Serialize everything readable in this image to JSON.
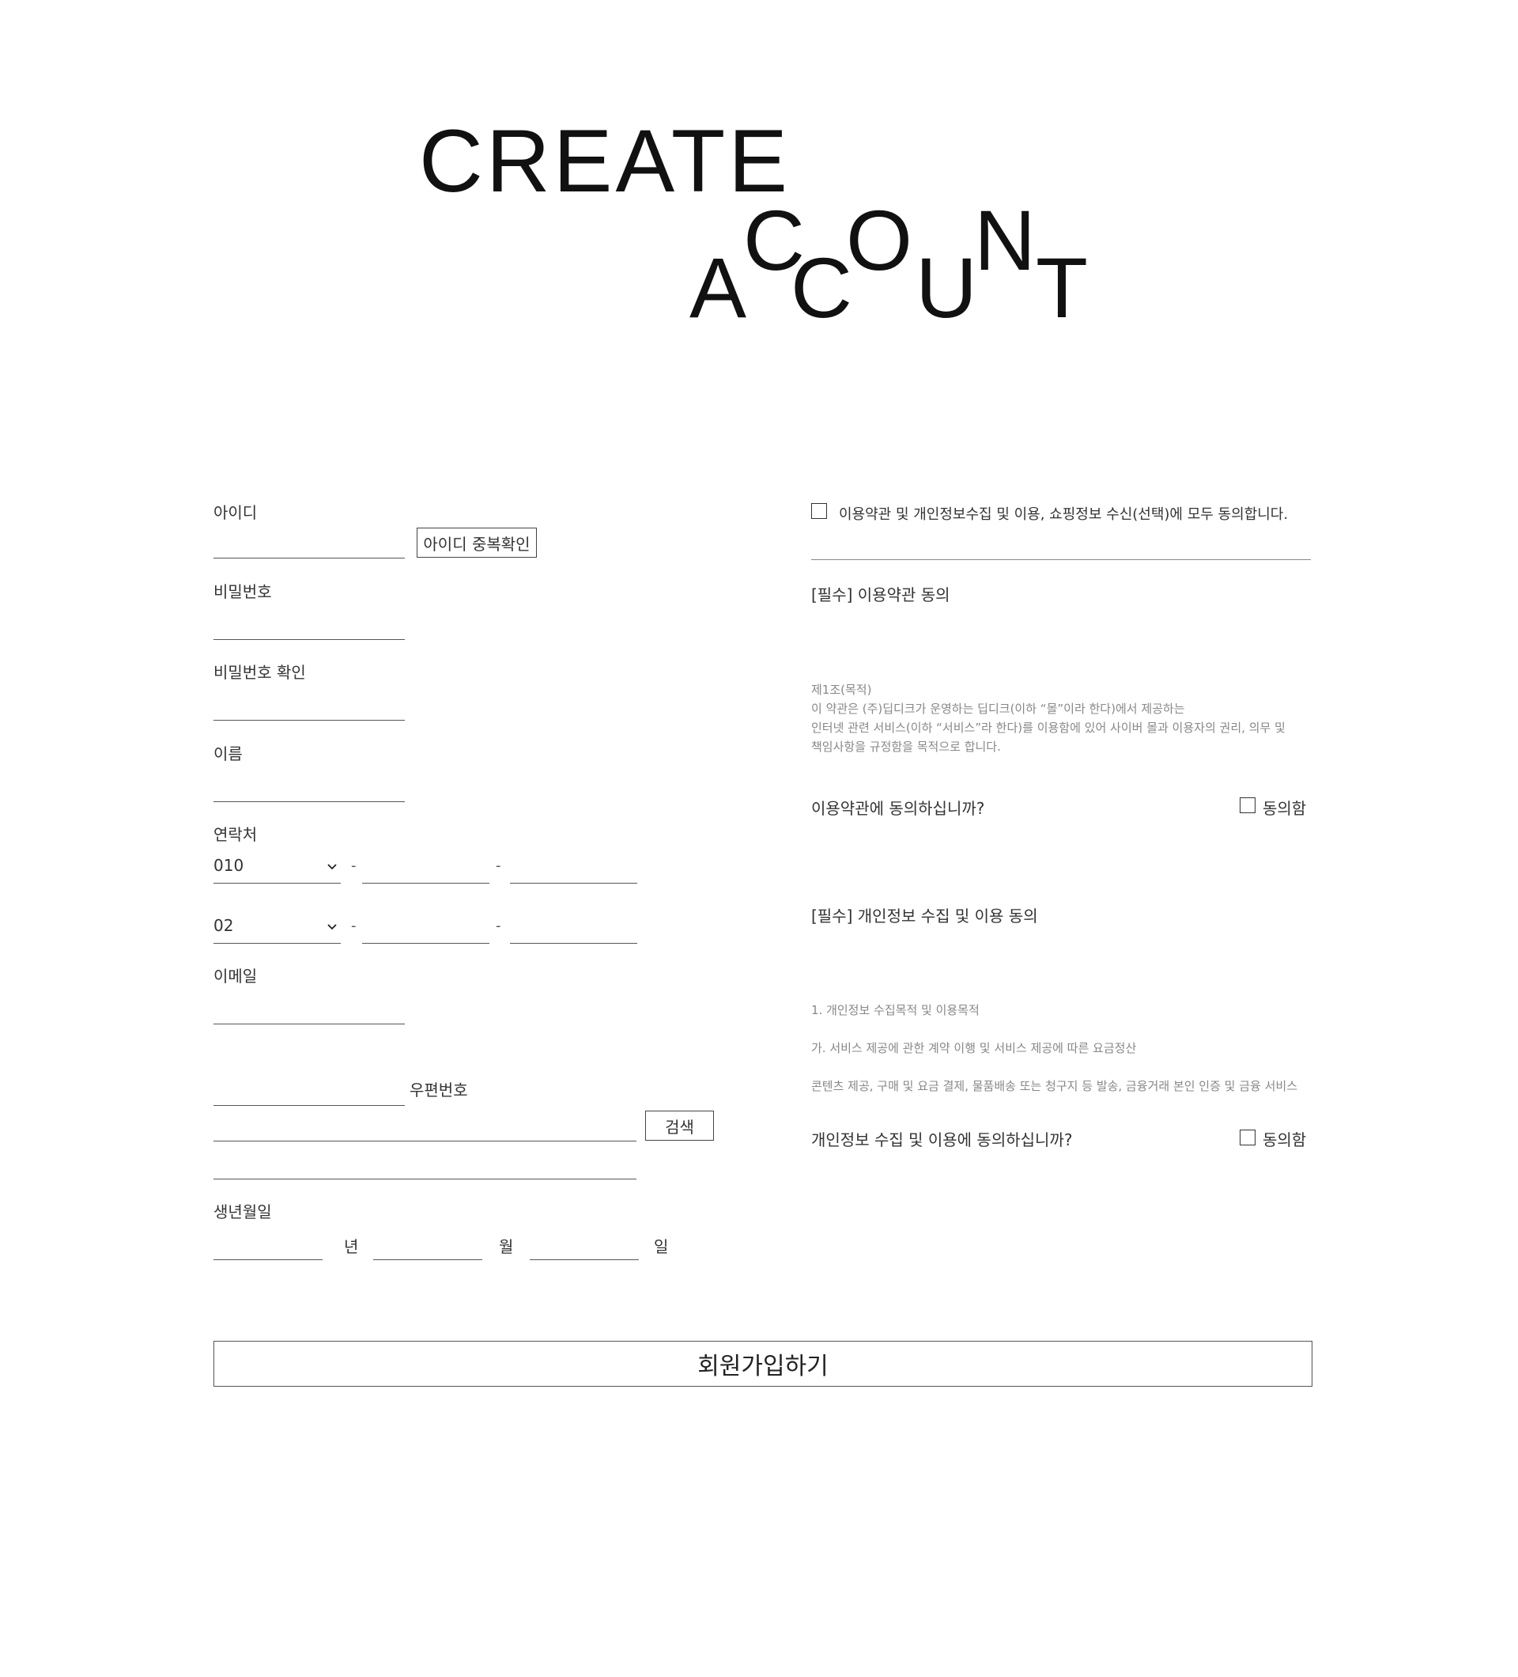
{
  "header": {
    "word1": "CREATE",
    "word2_letters": [
      "A",
      "C",
      "C",
      "O",
      "U",
      "N",
      "T"
    ]
  },
  "form": {
    "id_label": "아이디",
    "id_check_button": "아이디 중복확인",
    "password_label": "비밀번호",
    "password_confirm_label": "비밀번호 확인",
    "name_label": "이름",
    "contact_label": "연락처",
    "phone1_prefix": "010",
    "phone2_prefix": "02",
    "dash": "-",
    "email_label": "이메일",
    "postcode_label": "우편번호",
    "search_button": "검색",
    "birthday_label": "생년월일",
    "year_unit": "년",
    "month_unit": "월",
    "day_unit": "일",
    "submit_button": "회원가입하기"
  },
  "agreements": {
    "all_agree_text": "이용약관 및 개인정보수집 및 이용, 쇼핑정보 수신(선택)에 모두 동의합니다.",
    "terms_title": "[필수]  이용약관 동의",
    "terms_body": [
      "제1조(목적)",
      "이 약관은 (주)딥디크가 운영하는 딥디크(이하 “몰”이라 한다)에서 제공하는",
      "인터넷 관련 서비스(이하 “서비스”라 한다)를 이용함에 있어 사이버 몰과 이용자의 권리, 의무 및",
      "책임사항을 규정함을 목적으로 합니다."
    ],
    "terms_question": "이용약관에 동의하십니까?",
    "agree_label": "동의함",
    "privacy_title": "[필수] 개인정보 수집 및 이용 동의",
    "privacy_body": [
      "1. 개인정보 수집목적 및 이용목적",
      "가. 서비스 제공에 관한 계약 이행 및 서비스 제공에 따른 요금정산",
      "콘텐츠 제공, 구매 및 요금 결제, 물품배송 또는 청구지 등 발송, 금융거래 본인  인증 및 금융 서비스"
    ],
    "privacy_question": "개인정보 수집 및 이용에 동의하십니까?"
  }
}
